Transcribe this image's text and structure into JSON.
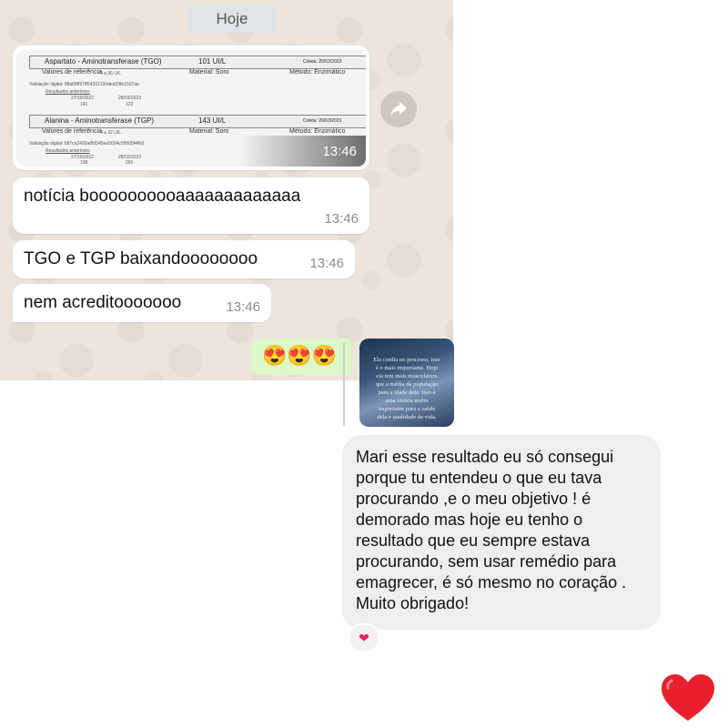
{
  "chat": {
    "date_pill": "Hoje",
    "lab_image": {
      "row1": {
        "label": "Aspartato - Aminotransferase (TGO)",
        "value": "101 UI/L",
        "coleta": "Coleta: 20/03/2023",
        "ref_label": "Valores de referência",
        "ref_value": "4 a 36 U/L",
        "material": "Material: Soro",
        "metodo": "Método: Enzimático",
        "validation": "Validação digital: 98a6f8f97854202150ded39fe1507ae",
        "prev_label": "Resultados anteriores",
        "prev_dates": [
          "27/10/2022",
          "28/03/2023"
        ],
        "prev_values": [
          "141",
          "123"
        ]
      },
      "row2": {
        "label": "Alanina - Aminotransferase (TGP)",
        "value": "143 UI/L",
        "coleta": "Coleta: 20/03/2023",
        "ref_label": "Valores de referência",
        "ref_value": "4 a 32 U/L",
        "material": "Material: Soro",
        "metodo": "Método: Enzimático",
        "validation": "Validação digital: b87ca2430a8fd345ea5004c09605f4f6d",
        "prev_label": "Resultados anteriores",
        "prev_dates": [
          "27/10/2022",
          "28/03/2023"
        ],
        "prev_values": [
          "198",
          "265"
        ]
      },
      "time": "13:46"
    },
    "messages": [
      {
        "text": "notícia boooooooooaaaaaaaaaaaaa",
        "time": "13:46"
      },
      {
        "text": "TGO e TGP baixandoooooooo",
        "time": "13:46"
      },
      {
        "text": "nem acreditooooooo",
        "time": "13:46"
      }
    ],
    "sent_emojis": "😍😍😍"
  },
  "story_reply": {
    "thumb_lines": [
      "Ela confia no processo, isso",
      "é o mais importante. Hoje",
      "ela tem mais musculatura",
      "que a média da população",
      "para a idade dela. Isso é",
      "uma vitória muito",
      "importante para a saúde",
      "dela e qualidade de vida."
    ],
    "message_lines": [
      "Mari esse resultado eu só consegui",
      "porque tu entendeu o que eu tava",
      "procurando ,e o meu objetivo ! é",
      "demorado mas hoje eu tenho o",
      "resultado que eu sempre estava",
      "procurando, sem usar remédio para",
      "emagrecer,  é só mesmo no coração .",
      "Muito obrigado!"
    ],
    "reaction": "❤",
    "big_heart": "❤️"
  },
  "colors": {
    "chat_bg": "#ece5dd",
    "sent_bubble": "#dcf8c6",
    "gray_bubble": "#efefef",
    "heart": "#e0245e"
  }
}
